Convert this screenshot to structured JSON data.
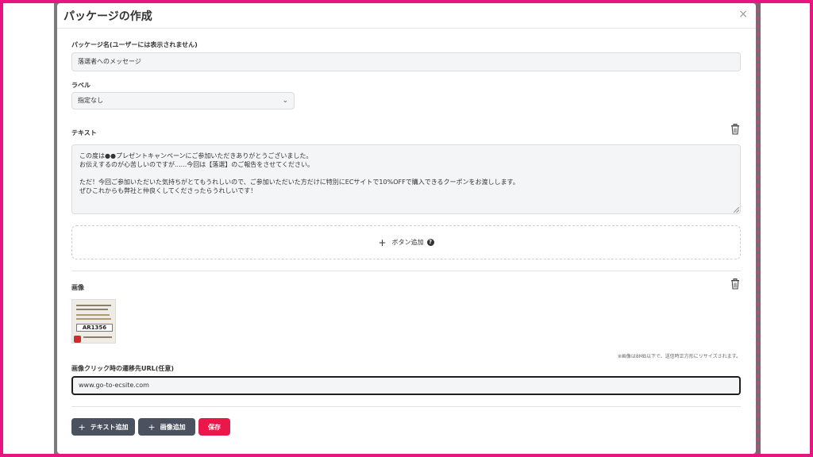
{
  "modal": {
    "title": "パッケージの作成",
    "close": "×"
  },
  "package_name": {
    "label": "パッケージ名(ユーザーには表示されません)",
    "value": "落選者へのメッセージ"
  },
  "label_select": {
    "label": "ラベル",
    "selected": "指定なし"
  },
  "text_section": {
    "label": "テキスト",
    "content": "この度は●●プレゼントキャンペーンにご参加いただきありがとうございました。\nお伝えするのが心苦しいのですが......今回は【落選】のご報告をさせてください。\n\nただ！今回ご参加いただいた気持ちがとてもうれしいので、ご参加いただいた方だけに特別にECサイトで10%OFFで購入できるクーポンをお渡しします。\nぜひこれからも弊社と仲良くしてくださったらうれしいです！"
  },
  "add_button": {
    "plus": "+",
    "label": "ボタン追加",
    "help": "?"
  },
  "image_section": {
    "label": "画像",
    "coupon_code": "AR1356",
    "note": "※画像は8MB以下で、送信時正方形にリサイズされます。"
  },
  "url_field": {
    "label": "画像クリック時の遷移先URL(任意)",
    "value": "www.go-to-ecsite.com"
  },
  "footer": {
    "plus": "+",
    "add_text": "テキスト追加",
    "add_image": "画像追加",
    "save": "保存"
  },
  "colors": {
    "frame": "#e6157f",
    "save": "#e8194a",
    "secondary_button": "#4a5260"
  }
}
